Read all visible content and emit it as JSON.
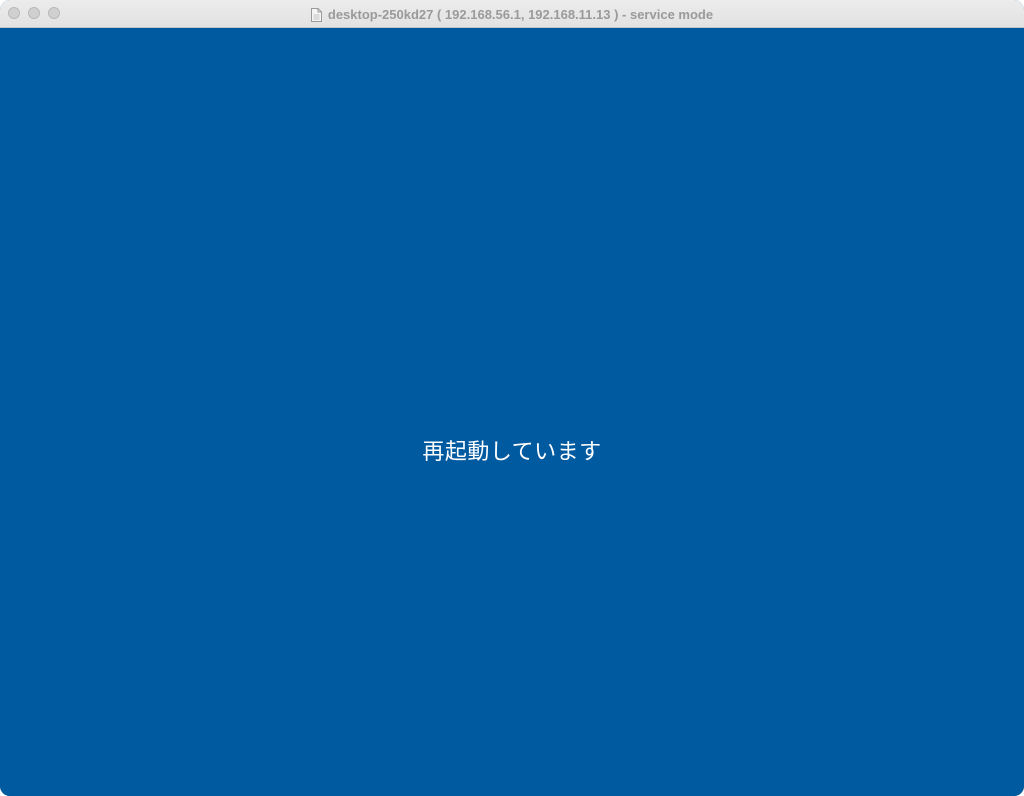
{
  "window": {
    "title": "desktop-250kd27 ( 192.168.56.1, 192.168.11.13 ) - service mode",
    "title_icon": "document-icon",
    "controls": [
      "close",
      "minimize",
      "zoom"
    ]
  },
  "screen": {
    "status_text": "再起動しています",
    "background_color": "#005aa0",
    "text_color": "#ffffff"
  }
}
